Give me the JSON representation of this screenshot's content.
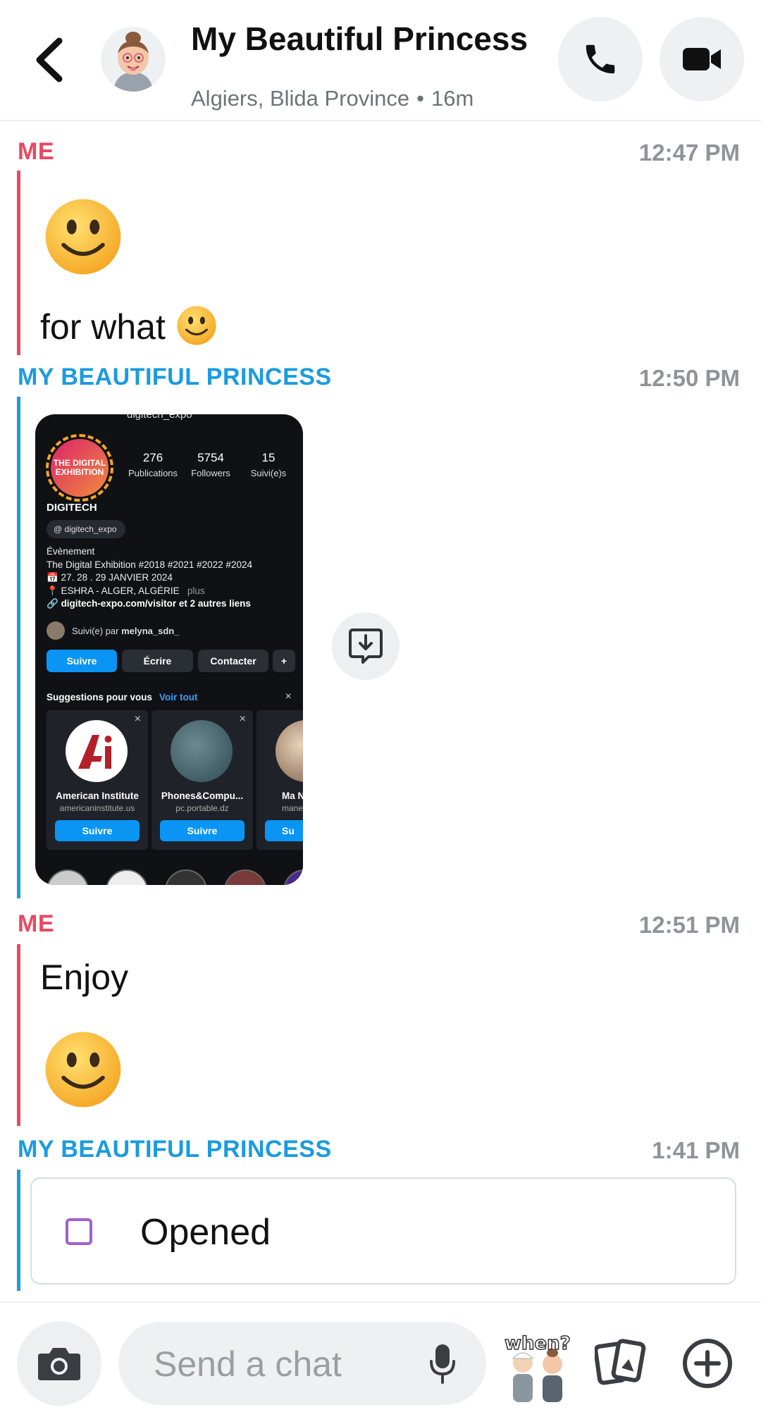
{
  "header": {
    "title": "My Beautiful Princess",
    "location": "Algiers, Blida Province",
    "separator": "•",
    "last_seen": "16m"
  },
  "messages": [
    {
      "sender": "ME",
      "time": "12:47 PM",
      "text": "for what"
    },
    {
      "sender": "MY BEAUTIFUL PRINCESS",
      "time": "12:50 PM",
      "type": "image"
    },
    {
      "sender": "ME",
      "time": "12:51 PM",
      "text": "Enjoy"
    },
    {
      "sender": "MY BEAUTIFUL PRINCESS",
      "time": "1:41 PM",
      "status": "Opened"
    }
  ],
  "snap_image": {
    "handle": "digitech_expo",
    "pfp_text": "THE DIGITAL EXHIBITION",
    "stats": [
      {
        "value": "276",
        "label": "Publications"
      },
      {
        "value": "5754",
        "label": "Followers"
      },
      {
        "value": "15",
        "label": "Suivi(e)s"
      }
    ],
    "name": "DIGITECH",
    "threads_tag": "digitech_expo",
    "bio": [
      "Évènement",
      "The Digital Exhibition #2018 #2021 #2022 #2024",
      "📅 27. 28 . 29  JANVIER 2024",
      "📍 ESHRA - ALGER, ALGÉRIE"
    ],
    "bio_more": "plus",
    "link": "digitech-expo.com/visitor et 2 autres liens",
    "followed_prefix": "Suivi(e) par",
    "followed_by": "melyna_sdn_",
    "buttons": [
      "Suivre",
      "Écrire",
      "Contacter"
    ],
    "suggestions_title": "Suggestions pour vous",
    "see_all": "Voir tout",
    "cards": [
      {
        "name": "American Institute",
        "handle": "americaninstitute.us",
        "button": "Suivre"
      },
      {
        "name": "Phones&Compu...",
        "handle": "pc.portable.dz",
        "button": "Suivre"
      },
      {
        "name": "Ma N",
        "handle": "mane",
        "button": "Su"
      }
    ]
  },
  "composer": {
    "placeholder": "Send a chat",
    "sticker_text": "when?"
  },
  "colors": {
    "me": "#e64a60",
    "her": "#1a9be0",
    "opened_square": "#a15fd0"
  }
}
